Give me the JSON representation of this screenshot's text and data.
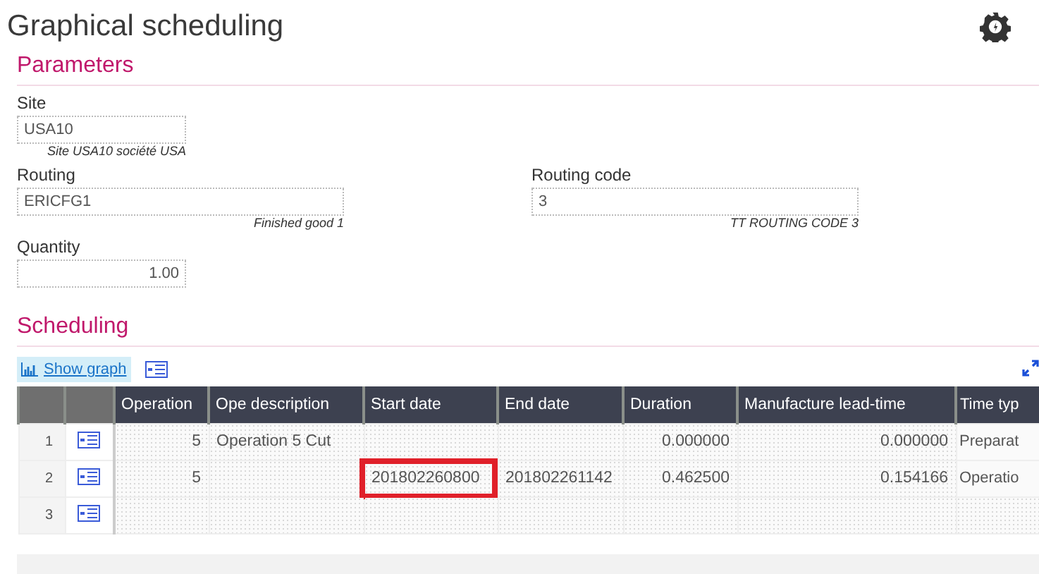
{
  "title": "Graphical scheduling",
  "parameters": {
    "heading": "Parameters",
    "fields": [
      {
        "label": "Site",
        "value": "USA10",
        "hint": "Site USA10 société USA",
        "kind": "code"
      },
      {
        "label": "Routing",
        "value": "ERICFG1",
        "hint": "Finished good 1",
        "kind": "reference"
      },
      {
        "label": "Routing code",
        "value": "3",
        "hint": "TT ROUTING CODE 3",
        "kind": "reference"
      },
      {
        "label": "Quantity",
        "value": "1.00",
        "kind": "number"
      }
    ]
  },
  "scheduling": {
    "heading": "Scheduling",
    "show_graph": "Show graph",
    "columns": [
      {
        "label": "Operation",
        "kind": "number"
      },
      {
        "label": "Ope description",
        "kind": "text"
      },
      {
        "label": "Start date",
        "kind": "text"
      },
      {
        "label": "End date",
        "kind": "text"
      },
      {
        "label": "Duration",
        "kind": "number"
      },
      {
        "label": "Manufacture lead-time",
        "kind": "number"
      },
      {
        "label": "Time typ",
        "kind": "text"
      }
    ],
    "rows": [
      {
        "number": "1",
        "cells": [
          {
            "text": "5",
            "highlighted": false
          },
          {
            "text": "Operation 5 Cut",
            "highlighted": false
          },
          {
            "highlighted": false
          },
          {
            "highlighted": false
          },
          {
            "text": "0.000000",
            "highlighted": false
          },
          {
            "text": "0.000000",
            "highlighted": false
          },
          {
            "text": "Preparat",
            "highlighted": false
          }
        ]
      },
      {
        "number": "2",
        "cells": [
          {
            "text": "5",
            "highlighted": false
          },
          {
            "highlighted": false
          },
          {
            "text": "201802260800",
            "highlighted": true
          },
          {
            "text": "201802261142",
            "highlighted": false
          },
          {
            "text": "0.462500",
            "highlighted": false
          },
          {
            "text": "0.154166",
            "highlighted": false
          },
          {
            "text": "Operatio",
            "highlighted": false
          }
        ]
      },
      {
        "number": "3",
        "cells": [
          {
            "highlighted": false
          },
          {
            "highlighted": false
          },
          {
            "highlighted": false
          },
          {
            "highlighted": false
          },
          {
            "highlighted": false
          },
          {
            "highlighted": false
          },
          {
            "highlighted": false
          }
        ]
      }
    ]
  }
}
